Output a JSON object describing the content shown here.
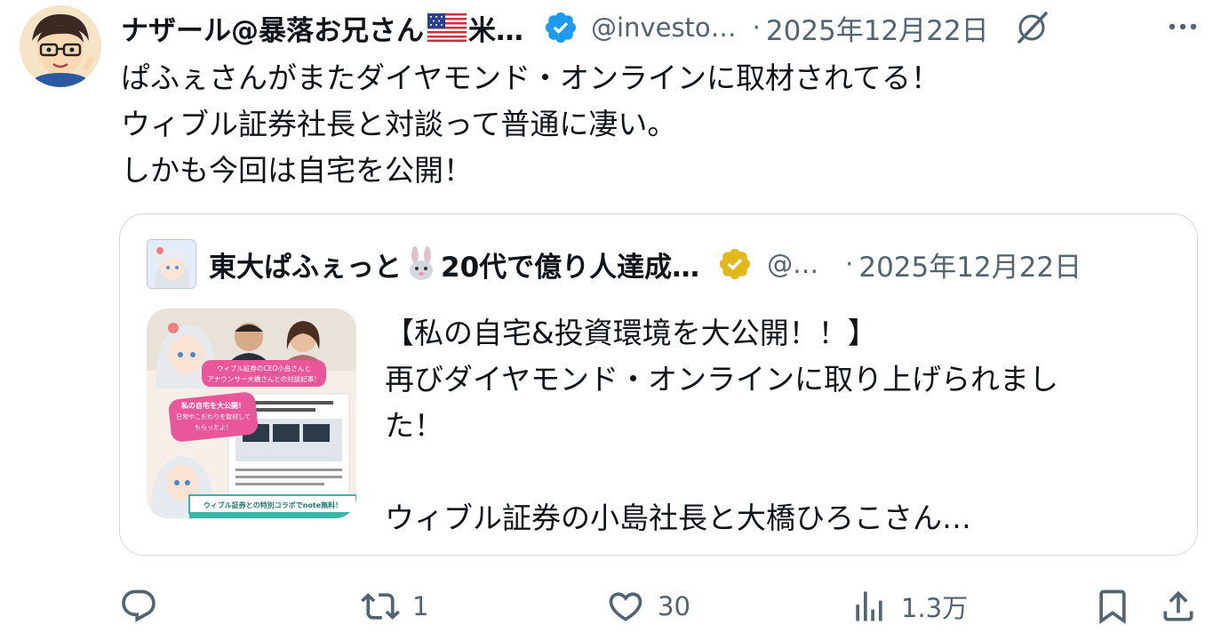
{
  "tweet": {
    "author_name": "ナザール@暴落お兄さん",
    "author_name_suffix": "米…",
    "handle": "@investo…",
    "date_sep": "·",
    "date": "2025年12月22日",
    "lines": [
      "ぱふぇさんがまたダイヤモンド・オンラインに取材されてる！",
      "ウィブル証券社長と対談って普通に凄い。",
      "しかも今回は自宅を公開！"
    ]
  },
  "quote": {
    "author_name": "東大ぱふぇっと",
    "author_name_suffix": "20代で億り人達成…",
    "handle": "@…",
    "date_sep": "·",
    "date": "2025年12月22日",
    "lines": [
      "【私の自宅&投資環境を大公開！！】",
      "再びダイヤモンド・オンラインに取り上げられまし",
      "た！",
      "",
      "ウィブル証券の小島社長と大橋ひろこさん…"
    ],
    "thumbnail": {
      "bubble_top": "ウィブル証券のCEO小島さんと",
      "bubble_top2": "アナウンサー大橋さんとの対談記事！",
      "bubble_mid": "私の自宅を大公開！",
      "bubble_mid2": "日常やこだわりを取材して",
      "bubble_mid3": "もらったよ！",
      "banner": "ウィブル証券との特別コラボでnote無料！"
    }
  },
  "actions": {
    "reply_count": "",
    "retweet_count": "1",
    "like_count": "30",
    "views_count": "1.3万"
  },
  "colors": {
    "text": "#0f1419",
    "secondary": "#536471",
    "verified_blue": "#1d9bf0",
    "verified_gold": "#e2b719",
    "border": "#cfd9de"
  }
}
